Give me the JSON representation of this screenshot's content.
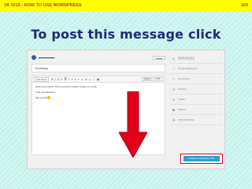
{
  "header": {
    "left": "VA 2015  -  HOW TO USE WORDPRESS",
    "page_number": "169",
    "bar_color": "#ffff00",
    "text_color": "#c0392b"
  },
  "slide": {
    "title": "To post this message click",
    "title_color": "#1e2a78"
  },
  "screenshot": {
    "post_title": "Greetings",
    "toolbar": {
      "add_media": "Add Media",
      "modes": [
        "Visual",
        "HTML"
      ]
    },
    "editor_lines": [
      "Hello every friend ! This is a post of a latest creator to my life.",
      "I love you students !",
      "See you all"
    ],
    "submit_label": "Publish to Wordpress (FB)",
    "submit_color": "#2a9fd6",
    "highlight_color": "#e0001b",
    "sidebar_items": [
      {
        "label": "Publish this post to",
        "sub": "Poster via Facebook",
        "icon": "person-icon"
      },
      {
        "label": "Format & Attachments",
        "sub": "",
        "icon": "plus-icon"
      },
      {
        "label": "Post Settings",
        "sub": "",
        "icon": "list-icon"
      },
      {
        "label": "Schedule",
        "sub": "",
        "icon": "clock-icon"
      },
      {
        "label": "Location",
        "sub": "",
        "icon": "pin-icon"
      },
      {
        "label": "Audience",
        "sub": "",
        "icon": "tag-icon"
      },
      {
        "label": "Advanced Settings",
        "sub": "",
        "icon": "gear-icon"
      }
    ]
  }
}
